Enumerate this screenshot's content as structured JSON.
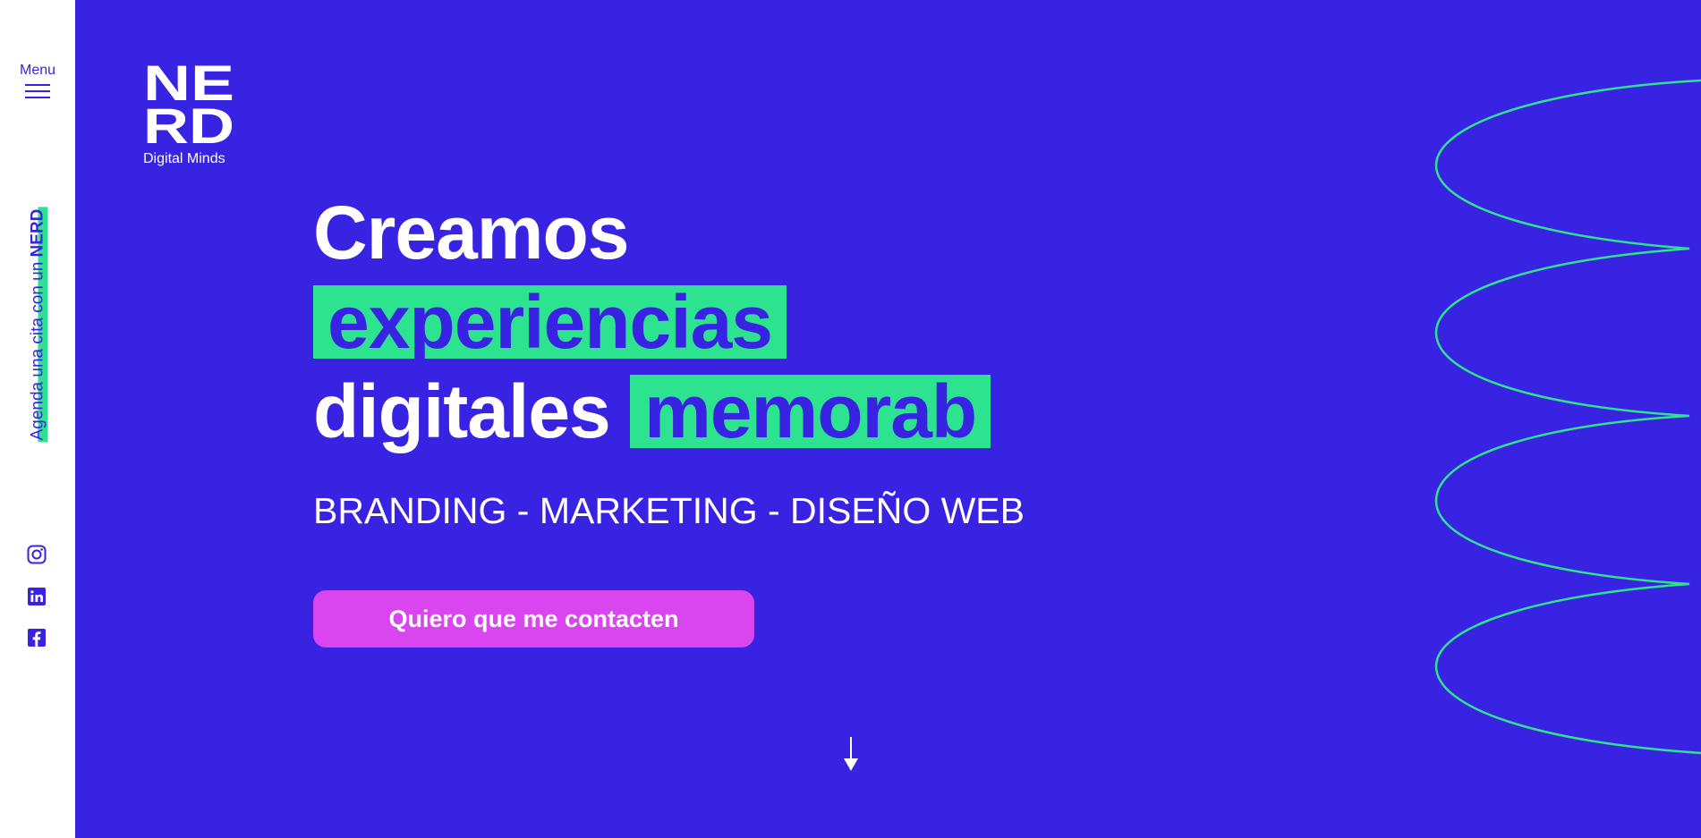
{
  "sidebar": {
    "menu_label": "Menu",
    "agenda_prefix": "Agenda una cita con un ",
    "agenda_brand": "NERD",
    "social": [
      {
        "name": "instagram-icon"
      },
      {
        "name": "linkedin-icon"
      },
      {
        "name": "facebook-icon"
      }
    ]
  },
  "logo": {
    "letters_top": "NE",
    "letters_bottom": "RD",
    "tagline": "Digital Minds"
  },
  "hero": {
    "line1": "Creamos",
    "line2_highlight": "experiencias",
    "line3_plain": "digitales ",
    "line3_highlight": "memorab",
    "subtitle": "BRANDING - MARKETING - DISEÑO WEB",
    "cta_label": "Quiero que me contacten"
  },
  "colors": {
    "background": "#3823e3",
    "accent_green": "#2de38f",
    "cta_magenta": "#d946ef",
    "sidebar": "#ffffff"
  }
}
